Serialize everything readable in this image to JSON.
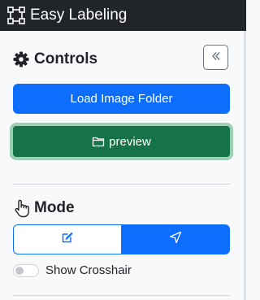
{
  "app": {
    "title": "Easy Labeling",
    "brand_icon": "bounding-box-icon"
  },
  "controls": {
    "title": "Controls",
    "title_icon": "gear-icon",
    "collapse_icon": "double-chevron-left-icon",
    "load_button_label": "Load Image Folder",
    "preview_button_label": "preview",
    "preview_icon": "folder-icon"
  },
  "mode": {
    "title": "Mode",
    "title_icon": "hand-pointer-icon",
    "options": [
      {
        "icon": "pencil-square-icon",
        "active": false
      },
      {
        "icon": "cursor-arrow-icon",
        "active": true
      }
    ]
  },
  "crosshair": {
    "label": "Show Crosshair",
    "enabled": false
  },
  "colors": {
    "topbar": "#212529",
    "primary": "#0d6efd",
    "success": "#157347",
    "success_focus_ring": "#9ccfb3"
  }
}
